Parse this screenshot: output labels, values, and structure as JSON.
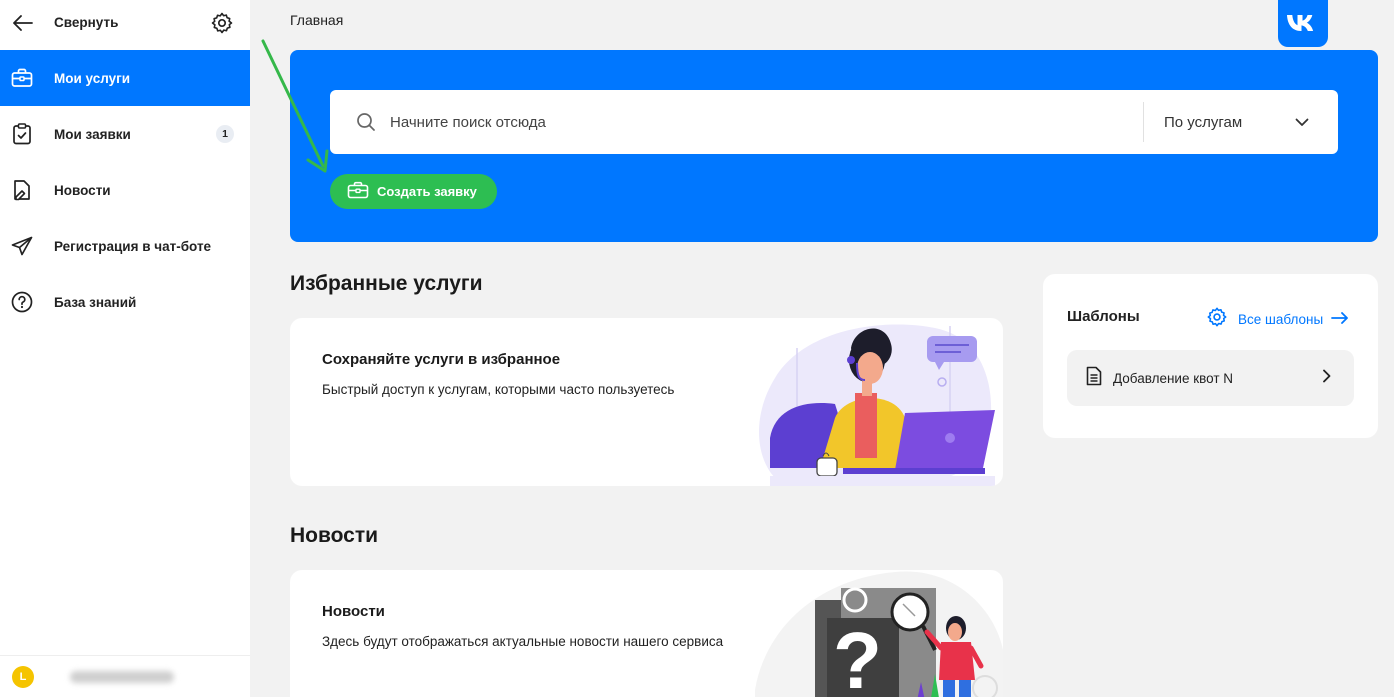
{
  "sidebar": {
    "collapse_label": "Свернуть",
    "items": [
      {
        "label": "Мои услуги",
        "icon": "briefcase-icon",
        "active": true
      },
      {
        "label": "Мои заявки",
        "icon": "clipboard-check-icon",
        "badge": "1"
      },
      {
        "label": "Новости",
        "icon": "news-icon"
      },
      {
        "label": "Регистрация в чат-боте",
        "icon": "paper-plane-icon"
      },
      {
        "label": "База знаний",
        "icon": "question-circle-icon"
      }
    ],
    "user": {
      "avatar_initial": "L"
    }
  },
  "header": {
    "breadcrumb": "Главная"
  },
  "search": {
    "placeholder": "Начните поиск отсюда",
    "scope_selected": "По услугам"
  },
  "create_button_label": "Создать заявку",
  "favorites": {
    "heading": "Избранные услуги",
    "card_title": "Сохраняйте услуги в избранное",
    "card_text": "Быстрый доступ к услугам, которыми часто пользуетесь"
  },
  "news": {
    "heading": "Новости",
    "card_title": "Новости",
    "card_text": "Здесь будут отображаться актуальные новости нашего сервиса"
  },
  "templates": {
    "title": "Шаблоны",
    "all_link": "Все шаблоны",
    "items": [
      {
        "label": "Добавление квот N"
      }
    ]
  },
  "colors": {
    "brand_blue": "#0077ff",
    "create_green": "#2dbe52",
    "annotation_arrow": "#35b84a",
    "background": "#f2f2f2"
  }
}
